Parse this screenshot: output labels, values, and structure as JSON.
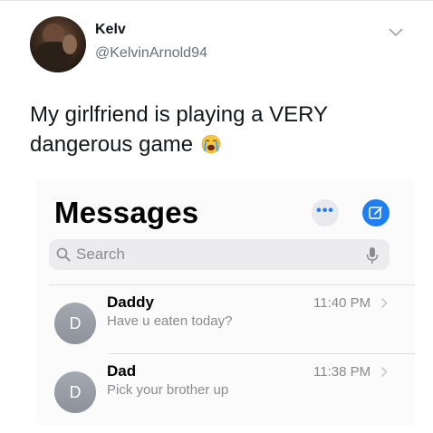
{
  "tweet": {
    "author_name": "Kelv",
    "author_handle": "@KelvinArnold94",
    "text": "My girlfriend is playing a VERY dangerous game",
    "emoji_icon": "crying-face-emoji"
  },
  "messages_app": {
    "title": "Messages",
    "search": {
      "placeholder": "Search"
    },
    "accent_color": "#1f7ef0",
    "conversations": [
      {
        "avatar_initial": "D",
        "name": "Daddy",
        "preview": "Have u eaten today?",
        "time": "11:40 PM"
      },
      {
        "avatar_initial": "D",
        "name": "Dad",
        "preview": "Pick your brother up",
        "time": "11:38 PM"
      }
    ]
  }
}
